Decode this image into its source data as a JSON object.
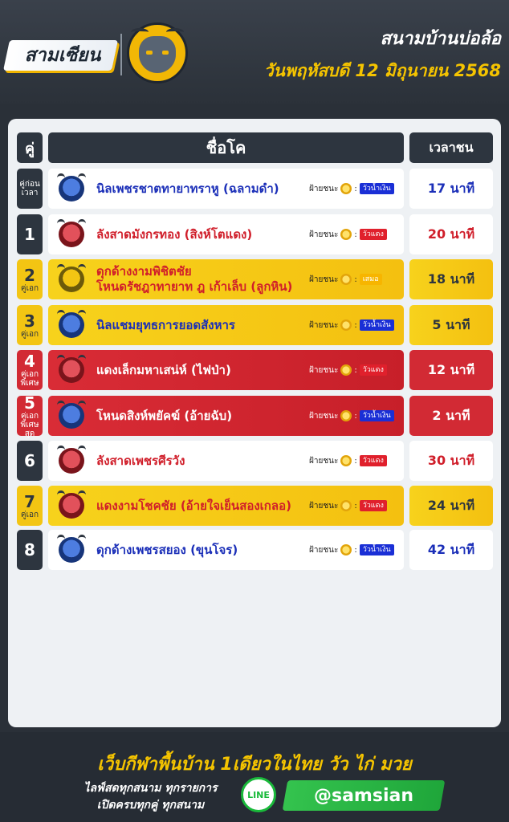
{
  "header": {
    "brand": "สามเซียน",
    "title": "สนามบ้านบ่อล้อ",
    "date": "วันพฤหัสบดี 12 มิถุนายน 2568"
  },
  "table": {
    "col_pair": "คู่",
    "col_name": "ชื่อโค",
    "col_time": "เวลาชน",
    "win_label": "ฝ้ายชนะ",
    "rows": [
      {
        "num": "",
        "sub": "คู่ก่อนเวลา",
        "names": [
          "นิลเพชรชาตทายาทราหู (ฉลามดำ)"
        ],
        "bull": "blue",
        "tag": "วัวน้ำเงิน",
        "tag_color": "blue",
        "time": "17 นาที",
        "style": "white"
      },
      {
        "num": "1",
        "sub": "",
        "names": [
          "ลังสาดมังกรทอง (สิงห์โตแดง)"
        ],
        "bull": "red",
        "tag": "วัวแดง",
        "tag_color": "red",
        "time": "20 นาที",
        "style": "white"
      },
      {
        "num": "2",
        "sub": "คู่เอก",
        "names": [
          "ดุกด้างงามพิชิตชัย",
          "โหนดรัชฎาทายาท ฎ เก้าเล็บ (ลูกหิน)"
        ],
        "bull": "gold",
        "tag": "เสมอ",
        "tag_color": "gold",
        "time": "18 นาที",
        "style": "gold"
      },
      {
        "num": "3",
        "sub": "คู่เอก",
        "names": [
          "นิลแชมยุทธการยอดสังหาร"
        ],
        "bull": "blue",
        "tag": "วัวน้ำเงิน",
        "tag_color": "blue",
        "time": "5 นาที",
        "style": "gold"
      },
      {
        "num": "4",
        "sub": "คู่เอกพิเศษ",
        "names": [
          "แดงเล็กมหาเสน่ห์ (ไฟป่า)"
        ],
        "bull": "red",
        "tag": "วัวแดง",
        "tag_color": "red",
        "time": "12 นาที",
        "style": "red"
      },
      {
        "num": "5",
        "sub": "คู่เอกพิเศษสุด",
        "names": [
          "โหนดสิงห์พยัคฆ์ (อ้ายฉับ)"
        ],
        "bull": "blue",
        "tag": "วัวน้ำเงิน",
        "tag_color": "blue",
        "time": "2 นาที",
        "style": "red"
      },
      {
        "num": "6",
        "sub": "",
        "names": [
          "ลังสาดเพชรศีรวัง"
        ],
        "bull": "red",
        "tag": "วัวแดง",
        "tag_color": "red",
        "time": "30 นาที",
        "style": "white"
      },
      {
        "num": "7",
        "sub": "คู่เอก",
        "names": [
          "แดงงามโชคชัย (อ้ายใจเย็นสองเกลอ)"
        ],
        "bull": "red",
        "tag": "วัวแดง",
        "tag_color": "red",
        "time": "24 นาที",
        "style": "gold"
      },
      {
        "num": "8",
        "sub": "",
        "names": [
          "ดุกด้างเพชรสยอง (ขุนโจร)"
        ],
        "bull": "blue",
        "tag": "วัวน้ำเงิน",
        "tag_color": "blue",
        "time": "42 นาที",
        "style": "white"
      }
    ]
  },
  "footer": {
    "headline": "เว็บกีฬาพื้นบ้าน 1เดียวในไทย วัว ไก่ มวย",
    "line2": "ไลฟ์สดทุกสนาม ทุกรายการ",
    "line3": "เปิดครบทุกคู่ ทุกสนาม",
    "line_badge": "LINE",
    "handle": "@samsian"
  },
  "colors": {
    "gold": "#f3c513",
    "red": "#d22a34",
    "blue": "#1b2fb8",
    "dark": "#2d353f"
  }
}
